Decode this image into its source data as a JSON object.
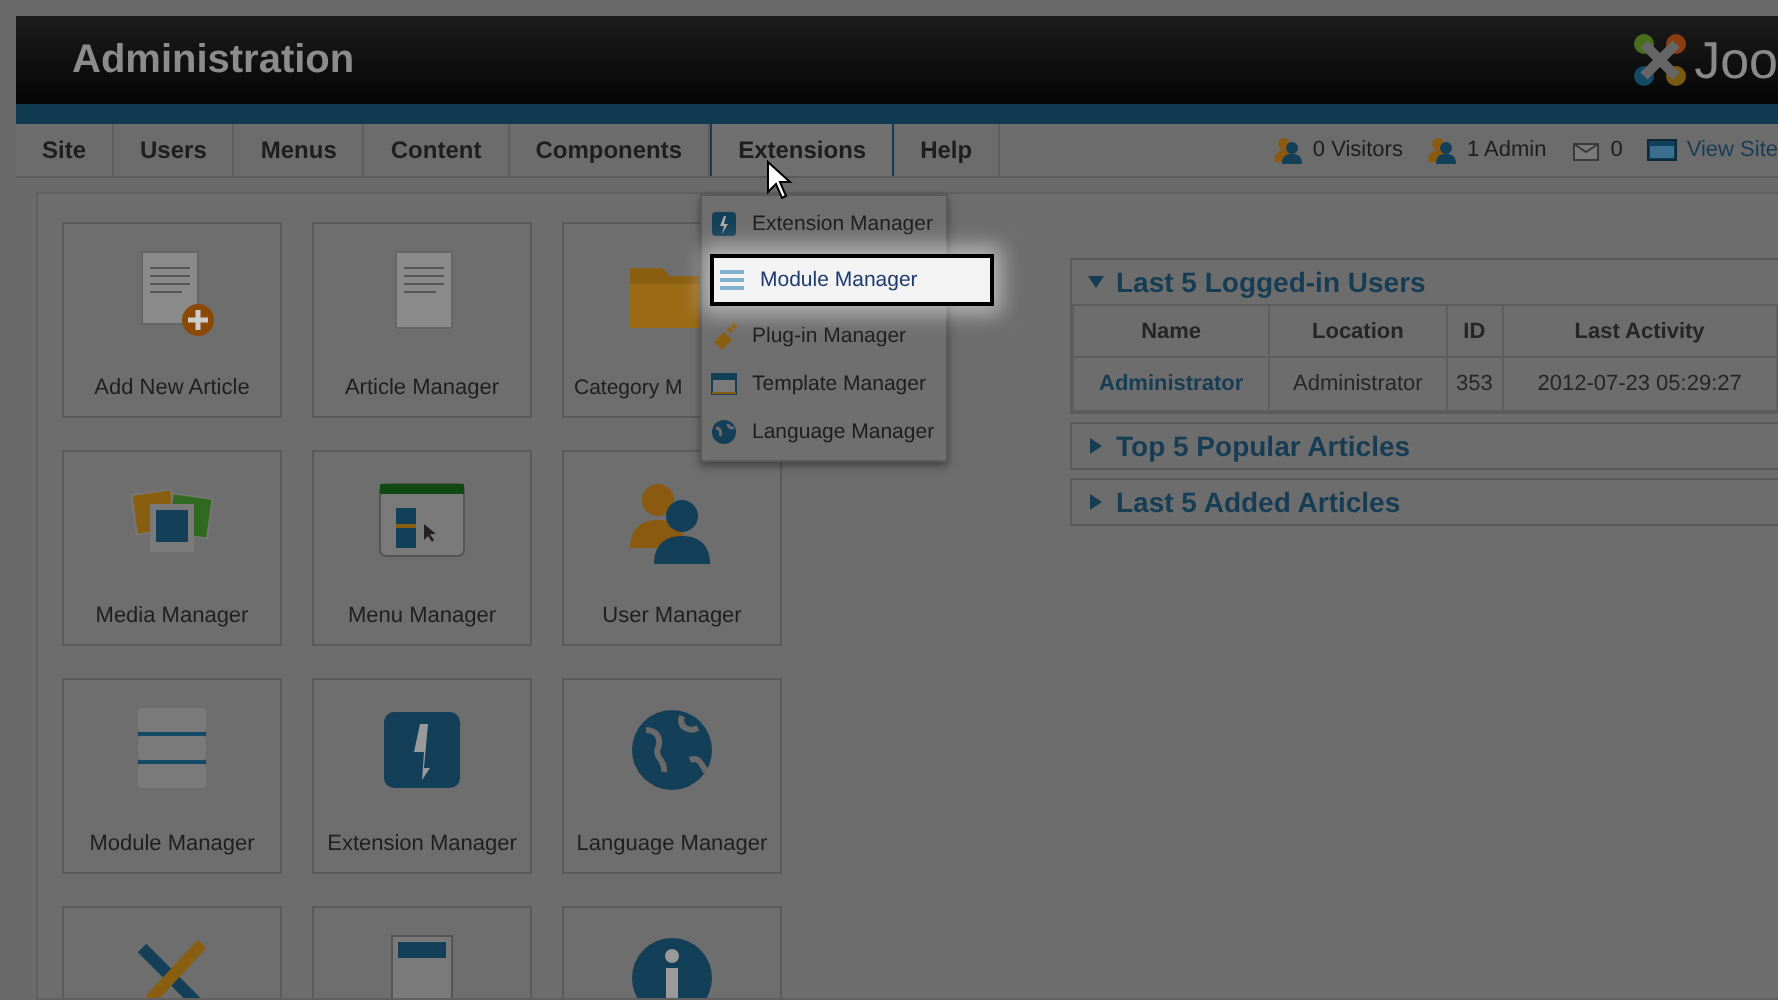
{
  "header": {
    "title": "Administration",
    "logo_text": "Joo"
  },
  "menu": [
    {
      "label": "Site",
      "selected": false
    },
    {
      "label": "Users",
      "selected": false
    },
    {
      "label": "Menus",
      "selected": false
    },
    {
      "label": "Content",
      "selected": false
    },
    {
      "label": "Components",
      "selected": false
    },
    {
      "label": "Extensions",
      "selected": true
    },
    {
      "label": "Help",
      "selected": false
    }
  ],
  "status": [
    {
      "kind": "visitors",
      "text": "0 Visitors"
    },
    {
      "kind": "admin",
      "text": "1 Admin"
    },
    {
      "kind": "messages",
      "text": "0"
    },
    {
      "kind": "site",
      "text": "View Site"
    }
  ],
  "dropdown": [
    {
      "label": "Extension Manager",
      "highlighted": false
    },
    {
      "label": "Module Manager",
      "highlighted": true
    },
    {
      "label": "Plug-in Manager",
      "highlighted": false
    },
    {
      "label": "Template Manager",
      "highlighted": false
    },
    {
      "label": "Language Manager",
      "highlighted": false
    }
  ],
  "tiles": [
    {
      "label": "Add New Article",
      "covered": false
    },
    {
      "label": "Article Manager",
      "covered": false
    },
    {
      "label": "Category M",
      "covered": true
    },
    {
      "label": "Media Manager",
      "covered": false
    },
    {
      "label": "Menu Manager",
      "covered": false
    },
    {
      "label": "User Manager",
      "covered": false
    },
    {
      "label": "Module Manager",
      "covered": false
    },
    {
      "label": "Extension Manager",
      "covered": false
    },
    {
      "label": "Language Manager",
      "covered": false
    }
  ],
  "panels": [
    {
      "title": "Last 5 Logged-in Users",
      "expanded": true,
      "table": {
        "columns": [
          "Name",
          "Location",
          "ID",
          "Last Activity"
        ],
        "rows": [
          [
            "Administrator",
            "Administrator",
            "353",
            "2012-07-23 05:29:27"
          ]
        ]
      }
    },
    {
      "title": "Top 5 Popular Articles",
      "expanded": false
    },
    {
      "title": "Last 5 Added Articles",
      "expanded": false
    }
  ]
}
